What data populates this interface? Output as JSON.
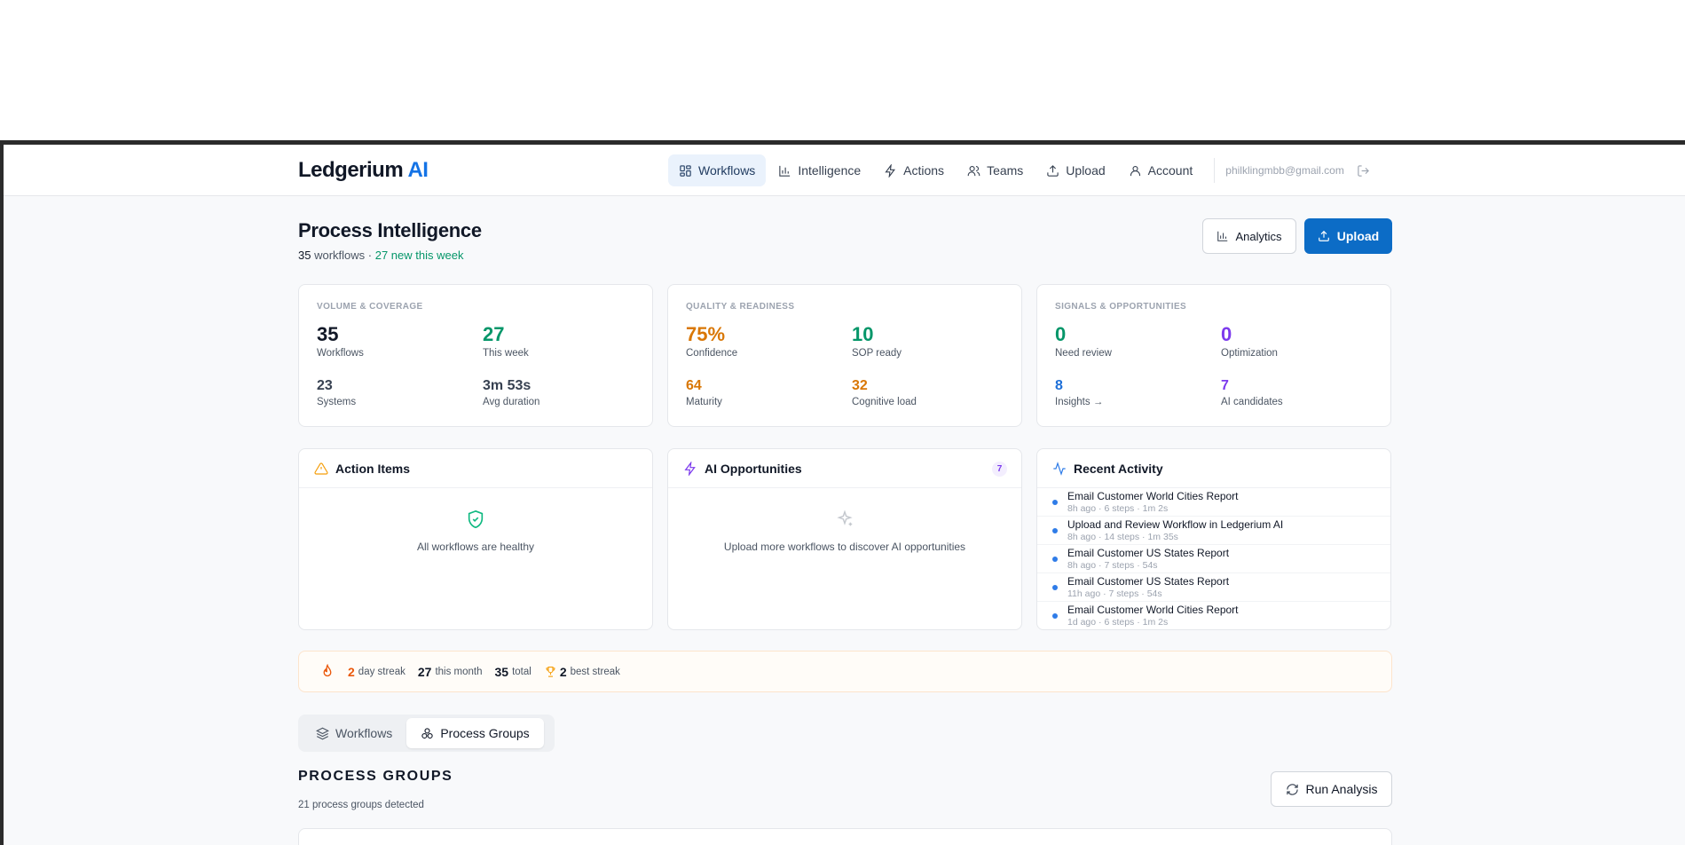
{
  "app": {
    "logo_main": "Ledgerium",
    "logo_accent": "AI"
  },
  "nav": {
    "items": [
      {
        "label": "Workflows",
        "icon": "grid-icon"
      },
      {
        "label": "Intelligence",
        "icon": "bar-chart-icon"
      },
      {
        "label": "Actions",
        "icon": "lightning-icon"
      },
      {
        "label": "Teams",
        "icon": "users-icon"
      },
      {
        "label": "Upload",
        "icon": "upload-icon"
      },
      {
        "label": "Account",
        "icon": "user-icon"
      }
    ],
    "email": "philklingmbb@gmail.com"
  },
  "page": {
    "title": "Process Intelligence",
    "sub_count": "35",
    "sub_text": "workflows ·",
    "sub_new": "27 new this week",
    "analytics_label": "Analytics",
    "upload_label": "Upload"
  },
  "volume": {
    "label": "VOLUME & COVERAGE",
    "workflows": {
      "value": "35",
      "label": "Workflows"
    },
    "this_week": {
      "value": "27",
      "label": "This week"
    },
    "systems": {
      "value": "23",
      "label": "Systems"
    },
    "avg_duration": {
      "value": "3m 53s",
      "label": "Avg duration"
    }
  },
  "quality": {
    "label": "QUALITY & READINESS",
    "confidence": {
      "value": "75%",
      "label": "Confidence"
    },
    "sop_ready": {
      "value": "10",
      "label": "SOP ready"
    },
    "maturity": {
      "value": "64",
      "label": "Maturity"
    },
    "cognitive": {
      "value": "32",
      "label": "Cognitive load"
    }
  },
  "signals": {
    "label": "SIGNALS & OPPORTUNITIES",
    "need_review": {
      "value": "0",
      "label": "Need review"
    },
    "optimization": {
      "value": "0",
      "label": "Optimization"
    },
    "insights": {
      "value": "8",
      "label": "Insights →"
    },
    "ai_candidates": {
      "value": "7",
      "label": "AI candidates"
    }
  },
  "action_items": {
    "title": "Action Items",
    "empty": "All workflows are healthy"
  },
  "ai_opps": {
    "title": "AI Opportunities",
    "count": "7",
    "empty": "Upload more workflows to discover AI opportunities"
  },
  "recent": {
    "title": "Recent Activity",
    "items": [
      {
        "title": "Email Customer World Cities Report",
        "meta": "8h ago · 6 steps · 1m 2s"
      },
      {
        "title": "Upload and Review Workflow in Ledgerium AI",
        "meta": "8h ago · 14 steps · 1m 35s"
      },
      {
        "title": "Email Customer US States Report",
        "meta": "8h ago · 7 steps · 54s"
      },
      {
        "title": "Email Customer US States Report",
        "meta": "11h ago · 7 steps · 54s"
      },
      {
        "title": "Email Customer World Cities Report",
        "meta": "1d ago · 6 steps · 1m 2s"
      }
    ]
  },
  "streak": {
    "day": "2",
    "day_label": "day streak",
    "month": "27",
    "month_label": "this month",
    "total": "35",
    "total_label": "total",
    "best": "2",
    "best_label": "best streak"
  },
  "tabs": {
    "workflows": "Workflows",
    "groups": "Process Groups"
  },
  "groups": {
    "title": "PROCESS GROUPS",
    "sub": "21 process groups detected",
    "run_label": "Run Analysis"
  }
}
